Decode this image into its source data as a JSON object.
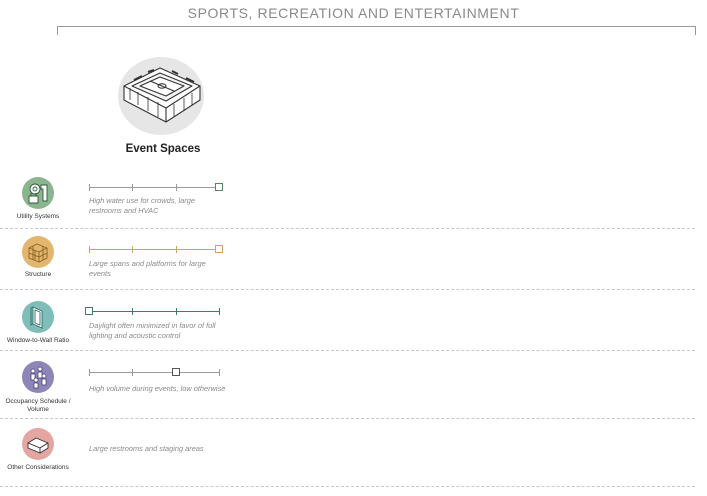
{
  "header": {
    "title": "SPORTS, RECREATION AND ENTERTAINMENT"
  },
  "column": {
    "title": "Event Spaces",
    "icon": "stadium-icon"
  },
  "rows": [
    {
      "label": "Utility Systems",
      "icon": "plumbing-utility-icon",
      "color": "#8bb58f",
      "scale_level": 1.0,
      "description": "High water use for crowds, large restrooms and HVAC"
    },
    {
      "label": "Structure",
      "icon": "structure-frame-icon",
      "color": "#e2b66e",
      "scale_level": 1.0,
      "description": "Large spans and platforms for large events"
    },
    {
      "label": "Window-to-Wall Ratio",
      "icon": "window-panel-icon",
      "color": "#7fbdb9",
      "scale_level": 0.0,
      "description": "Daylight often minimized in favor of full lighting and acoustic control"
    },
    {
      "label": "Occupancy Schedule / Volume",
      "icon": "occupancy-people-icon",
      "color": "#8f86b8",
      "scale_level": 0.67,
      "description": "High volume during events, low otherwise"
    },
    {
      "label": "Other Considerations",
      "icon": "box-volume-icon",
      "color": "#e4a6a0",
      "description": "Large restrooms and staging areas"
    }
  ],
  "colors": {
    "scale_gray": "#9a9a9a",
    "utility_green": "#4f8a5c",
    "structure_gold": "#d6a24f",
    "window_teal": "#3d7d6d"
  }
}
